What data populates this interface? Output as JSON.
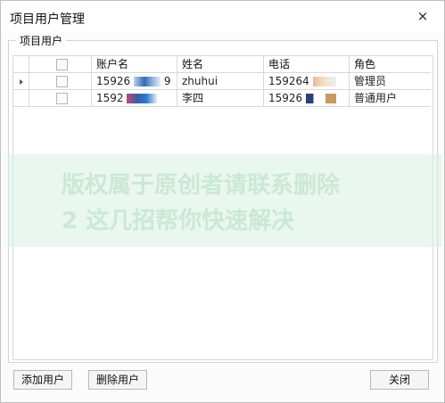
{
  "window": {
    "title": "项目用户管理",
    "close_glyph": "×"
  },
  "group": {
    "title": "项目用户"
  },
  "table": {
    "columns": [
      "账户名",
      "姓名",
      "电话",
      "角色"
    ],
    "rows": [
      {
        "account": "15926",
        "account_tail": "9",
        "name": "zhuhui",
        "phone": "159264",
        "role": "管理员",
        "current": true
      },
      {
        "account": "1592",
        "account_tail": "",
        "name": "李四",
        "phone": "15926",
        "role": "普通用户",
        "current": false
      }
    ]
  },
  "watermark": {
    "line1": "版权属于原创者请联系删除",
    "line2": "2 这几招帮你快速解决"
  },
  "buttons": {
    "add_user": "添加用户",
    "delete_user": "删除用户",
    "close": "关闭"
  }
}
